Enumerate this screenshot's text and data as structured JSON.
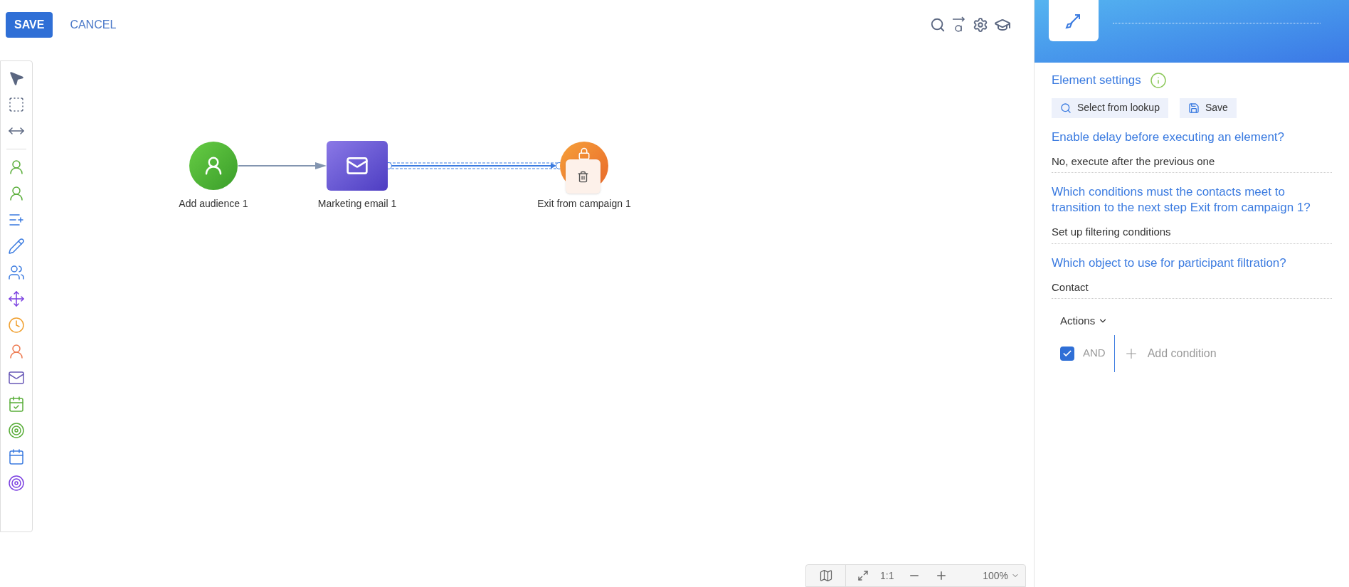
{
  "toolbar": {
    "save": "SAVE",
    "cancel": "CANCEL"
  },
  "nodes": [
    {
      "kind": "audience",
      "label": "Add audience 1"
    },
    {
      "kind": "email",
      "label": "Marketing email 1"
    },
    {
      "kind": "exit",
      "label": "Exit from campaign 1"
    }
  ],
  "connections": [
    {
      "selected": false
    },
    {
      "selected": true
    }
  ],
  "zoom_bar": {
    "actual_size": "1:1",
    "zoom": "100%"
  },
  "panel": {
    "title": "Element settings",
    "buttons": [
      "Select from lookup",
      "Save"
    ],
    "fields": [
      {
        "question": "Enable delay before executing an element?",
        "value": "No, execute after the previous one"
      },
      {
        "question": "Which conditions must the contacts meet to transition to the next step Exit from campaign 1?",
        "value": "Set up filtering conditions"
      },
      {
        "question": "Which object to use for participant filtration?",
        "value": "Contact"
      }
    ],
    "filter": {
      "actions": "Actions",
      "and_checked": true,
      "and_label": "AND",
      "add": "Add condition"
    }
  }
}
